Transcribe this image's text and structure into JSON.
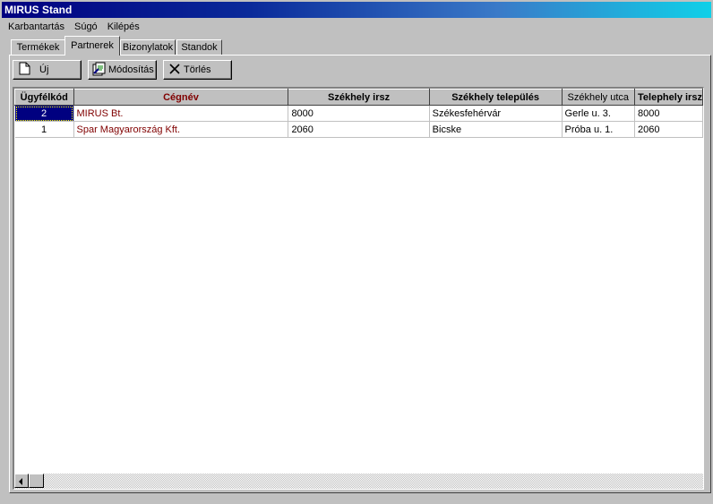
{
  "window": {
    "title": "MIRUS Stand"
  },
  "menu": [
    {
      "label": "Karbantartás"
    },
    {
      "label": "Súgó"
    },
    {
      "label": "Kilépés"
    }
  ],
  "tabs": [
    {
      "label": "Termékek"
    },
    {
      "label": "Partnerek"
    },
    {
      "label": "Bizonylatok"
    },
    {
      "label": "Standok"
    }
  ],
  "active_tab": "Partnerek",
  "toolbar": {
    "new_label": "Új",
    "edit_label": "Módosítás",
    "delete_label": "Törlés"
  },
  "grid": {
    "columns": [
      "Ügyfélkód",
      "Cégnév",
      "Székhely irsz",
      "Székhely település",
      "Székhely utca",
      "Telephely irsz"
    ],
    "rows": [
      [
        "2",
        "MIRUS Bt.",
        "8000",
        "Székesfehérvár",
        "Gerle u. 3.",
        "8000"
      ],
      [
        "1",
        "Spar Magyarország Kft.",
        "2060",
        "Bicske",
        "Próba u. 1.",
        "2060"
      ]
    ]
  },
  "colors": {
    "title_start": "#000080",
    "title_end": "#10d0e8",
    "accent_text": "#800000",
    "selection": "#000080"
  }
}
